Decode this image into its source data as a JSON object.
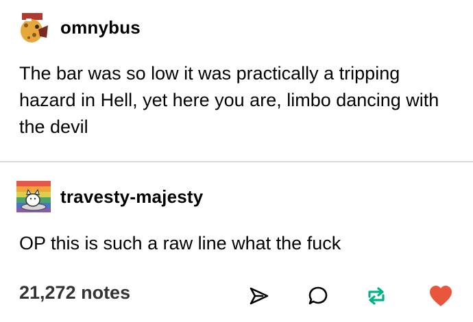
{
  "posts": [
    {
      "username": "omnybus",
      "avatar_icon": "giraffe-avatar-icon",
      "text": "The bar was so low it was practically a tripping hazard in Hell, yet here you are, limbo dancing with the devil"
    },
    {
      "username": "travesty-majesty",
      "avatar_icon": "cat-on-rainbow-avatar-icon",
      "text": "OP this is such a raw line what the fuck"
    }
  ],
  "footer": {
    "notes": "21,272 notes",
    "actions": [
      "share-icon",
      "reply-icon",
      "reblog-icon",
      "like-icon"
    ]
  },
  "colors": {
    "reblog": "#00b386",
    "like": "#e8573b",
    "divider": "#d9d9d9"
  }
}
